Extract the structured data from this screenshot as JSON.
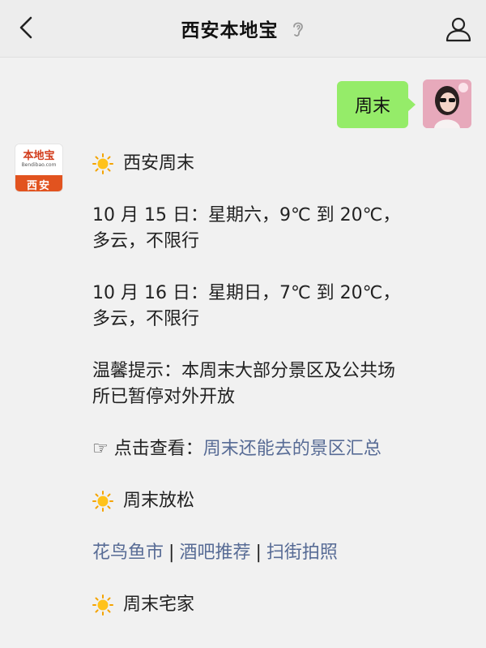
{
  "header": {
    "title": "西安本地宝"
  },
  "user_message": {
    "text": "周末"
  },
  "bot": {
    "avatar": {
      "logo_text": "本地宝",
      "logo_sub": "Bendibao.com",
      "city": "西安"
    },
    "section1_title": "西安周末",
    "day1": "10 月 15 日：星期六，9℃ 到 20℃，多云，不限行",
    "day2": "10 月 16 日：星期日，7℃ 到 20℃，多云，不限行",
    "notice": "温馨提示：本周末大部分景区及公共场所已暂停对外开放",
    "check_prefix": "☞ 点击查看：",
    "check_link": "周末还能去的景区汇总",
    "section2_title": "周末放松",
    "links": [
      "花鸟鱼市",
      "酒吧推荐",
      "扫街拍照"
    ],
    "separator": "|",
    "section3_title": "周末宅家"
  },
  "colors": {
    "topbar_bg": "#ededed",
    "chat_bg": "#f1f1f1",
    "user_bubble": "#95ec69",
    "link": "#576b95",
    "logo_orange": "#e2531f"
  },
  "icons": [
    "back-chevron-icon",
    "ear-icon",
    "person-icon",
    "sun-icon"
  ]
}
